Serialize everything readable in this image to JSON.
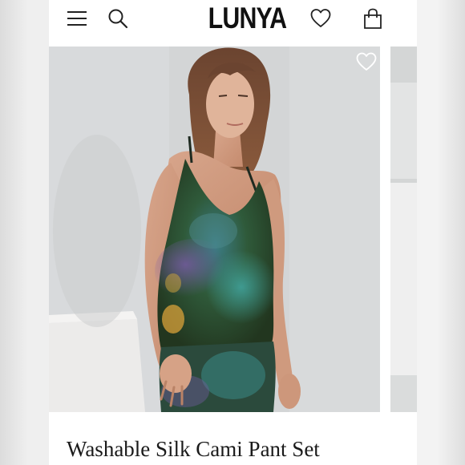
{
  "header": {
    "logo_text": "LUNYA",
    "icons": [
      "menu-icon",
      "search-icon",
      "heart-icon",
      "shopping-bag-icon"
    ]
  },
  "gallery": {
    "main_image": "model-wearing-printed-silk-cami",
    "overlay_icon": "heart-outline-icon"
  },
  "product": {
    "title": "Washable Silk Cami Pant Set"
  },
  "colors": {
    "background": "#f2f2f2",
    "text": "#1a1a1a",
    "photo_backdrop": "#d4d6d6",
    "print_green": "#2f4a2c",
    "print_teal": "#2f7f7c",
    "print_purple": "#5d4a86"
  }
}
